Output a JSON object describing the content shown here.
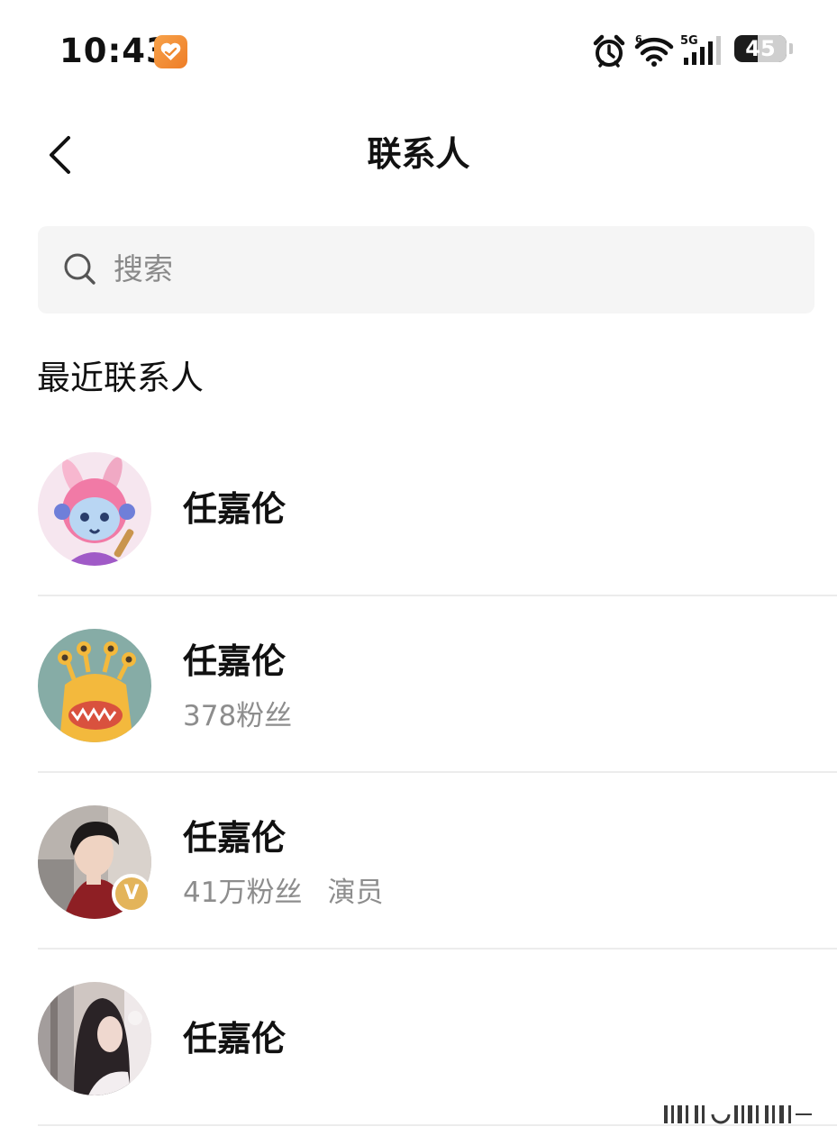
{
  "status_bar": {
    "time": "10:43",
    "battery_level": "45",
    "battery_fraction": 0.45,
    "network_label": "5G",
    "wifi_badge": "6",
    "icons": [
      "app-notification-icon",
      "alarm-icon",
      "wifi-icon",
      "cellular-signal-icon",
      "battery-icon"
    ]
  },
  "header": {
    "title": "联系人",
    "back_icon": "chevron-left-icon"
  },
  "search": {
    "placeholder": "搜索",
    "icon": "search-icon"
  },
  "section": {
    "title": "最近联系人"
  },
  "contacts": [
    {
      "name": "任嘉伦",
      "followers": "",
      "role": "",
      "verified": false,
      "avatar": "cartoon-rabbit-avatar"
    },
    {
      "name": "任嘉伦",
      "followers": "378粉丝",
      "role": "",
      "verified": false,
      "avatar": "monster-avatar"
    },
    {
      "name": "任嘉伦",
      "followers": "41万粉丝",
      "role": "演员",
      "verified": true,
      "verified_label": "V",
      "avatar": "photo-avatar"
    },
    {
      "name": "任嘉伦",
      "followers": "",
      "role": "",
      "verified": false,
      "avatar": "photo-avatar"
    }
  ],
  "colors": {
    "search_bg": "#f5f5f5",
    "secondary_text": "#8d8d8d",
    "divider": "#ececec",
    "verified_badge": "#e3b45a",
    "app_icon": "#f08a30"
  }
}
